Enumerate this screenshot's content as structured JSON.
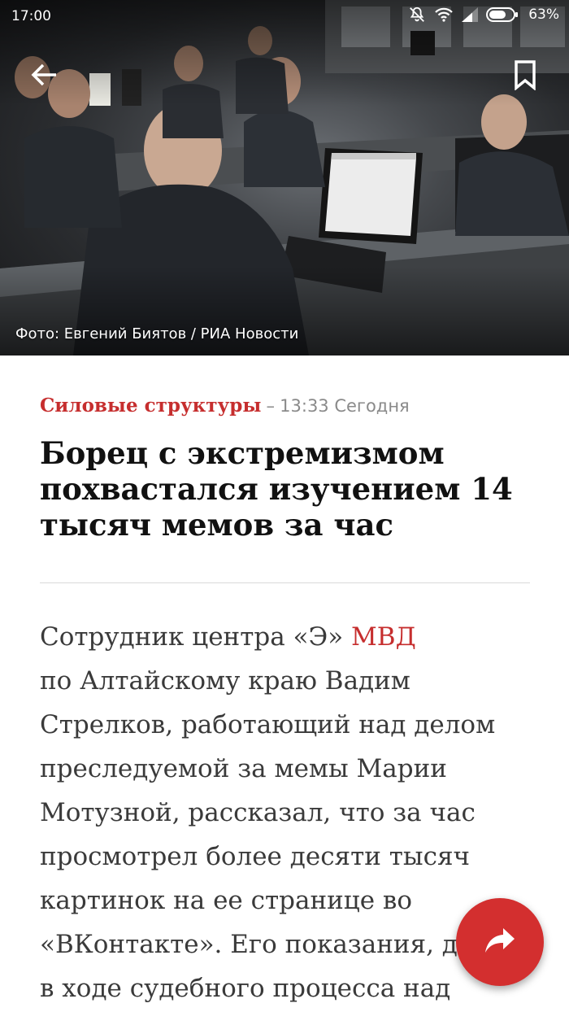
{
  "status_bar": {
    "time": "17:00",
    "battery": "63%",
    "icons": [
      "mute-icon",
      "wifi-icon",
      "signal-icon",
      "battery-icon"
    ]
  },
  "hero": {
    "photo_credit": "Фото: Евгений Биятов / РИА Новости",
    "back_icon": "arrow-left-icon",
    "bookmark_icon": "bookmark-icon"
  },
  "article": {
    "category": "Силовые структуры",
    "separator": "–",
    "time": "13:33 Сегодня",
    "headline_lines": [
      "Борец с экстремизмом",
      "похвастался изучением 14",
      "тысяч мемов за час"
    ],
    "body": {
      "line1_before_link": "Сотрудник центра «Э» ",
      "link_text": "МВД",
      "lines": [
        "по Алтайскому краю Вадим",
        "Стрелков, работающий над делом",
        "преследуемой за мемы Марии",
        "Мотузной, рассказал, что за час",
        "просмотрел более десяти тысяч",
        "картинок на ее странице во",
        "«ВКонтакте». Его показания, да",
        "в ходе судебного процесса над"
      ]
    }
  },
  "share": {
    "icon": "share-icon"
  },
  "colors": {
    "accent": "#c62e2e",
    "fab": "#d32f2f",
    "meta_gray": "#8a8a8a",
    "headline": "#111111",
    "body": "#3a3a3a"
  }
}
